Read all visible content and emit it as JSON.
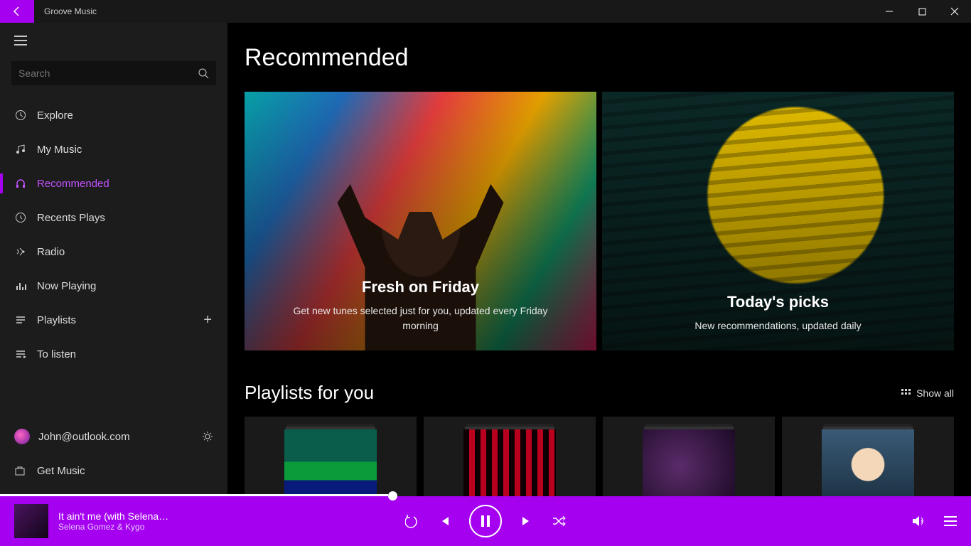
{
  "app": {
    "title": "Groove Music"
  },
  "search": {
    "placeholder": "Search"
  },
  "sidebar": {
    "items": [
      {
        "label": "Explore"
      },
      {
        "label": "My Music"
      },
      {
        "label": "Recommended"
      },
      {
        "label": "Recents Plays"
      },
      {
        "label": "Radio"
      },
      {
        "label": "Now Playing"
      },
      {
        "label": "Playlists"
      },
      {
        "label": "To listen"
      }
    ],
    "user": "John@outlook.com",
    "get_music": "Get Music"
  },
  "main": {
    "heading": "Recommended",
    "hero": [
      {
        "title": "Fresh on Friday",
        "subtitle": "Get new tunes selected just for you, updated every Friday morning"
      },
      {
        "title": "Today's picks",
        "subtitle": "New recommendations, updated daily"
      }
    ],
    "playlists_heading": "Playlists for you",
    "show_all": "Show all"
  },
  "player": {
    "track": "It ain't me (with Selena…",
    "artist": "Selena Gomez & Kygo"
  }
}
